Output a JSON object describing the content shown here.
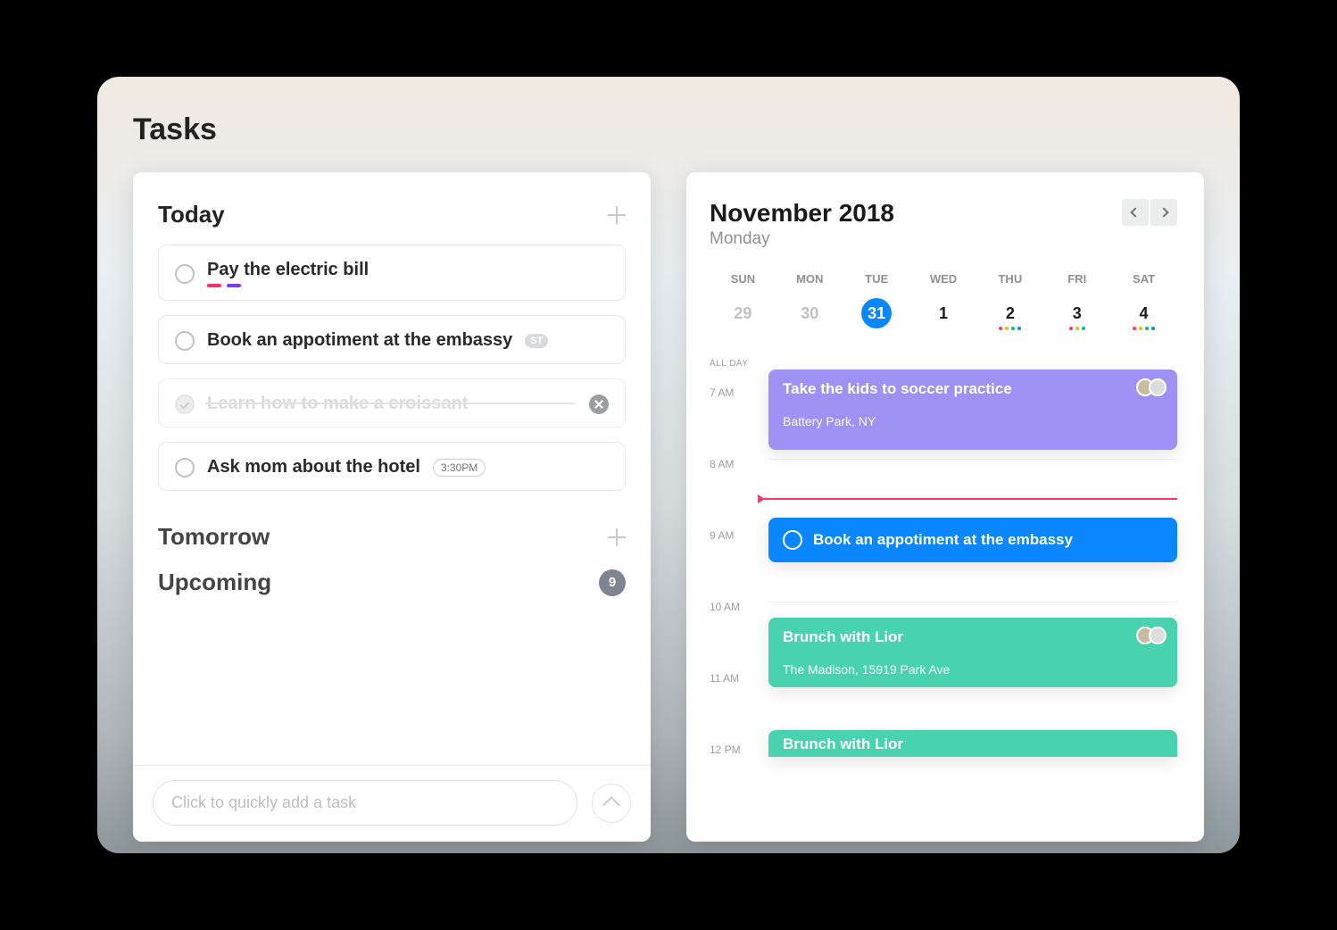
{
  "page_title": "Tasks",
  "tasks": {
    "sections": {
      "today": {
        "title": "Today",
        "items": [
          {
            "title": "Pay the electric bill",
            "tags": [
              "#ff3366",
              "#8034ff"
            ]
          },
          {
            "title": "Book an appotiment at the embassy",
            "badge": "ST"
          },
          {
            "title": "Learn how to make a croissant",
            "done": true
          },
          {
            "title": "Ask mom about the hotel",
            "time": "3:30PM"
          }
        ]
      },
      "tomorrow": {
        "title": "Tomorrow"
      },
      "upcoming": {
        "title": "Upcoming",
        "count": "9"
      }
    },
    "quick_add_placeholder": "Click to quickly add a task"
  },
  "calendar": {
    "title": "November 2018",
    "subtitle": "Monday",
    "week_labels": [
      "SUN",
      "MON",
      "TUE",
      "WED",
      "THU",
      "FRI",
      "SAT"
    ],
    "days": [
      {
        "num": "29",
        "muted": true
      },
      {
        "num": "30",
        "muted": true
      },
      {
        "num": "31",
        "active": true
      },
      {
        "num": "1"
      },
      {
        "num": "2",
        "dots": [
          "#ff3366",
          "#ffb300",
          "#00c27a",
          "#0a86ff"
        ]
      },
      {
        "num": "3",
        "dots": [
          "#ff3366",
          "#ffb300",
          "#00c27a"
        ]
      },
      {
        "num": "4",
        "dots": [
          "#ff3366",
          "#ffb300",
          "#00c27a",
          "#0a86ff"
        ]
      }
    ],
    "all_day_label": "ALL DAY",
    "hours": [
      "7 AM",
      "8 AM",
      "9 AM",
      "10 AM",
      "11 AM",
      "12 PM"
    ],
    "events": {
      "soccer": {
        "title": "Take the kids to soccer practice",
        "location": "Battery Park, NY"
      },
      "embassy": {
        "title": "Book an appotiment at the embassy"
      },
      "brunch1": {
        "title": "Brunch with Lior",
        "location": "The Madison, 15919 Park Ave"
      },
      "brunch2": {
        "title": "Brunch with Lior"
      }
    }
  }
}
